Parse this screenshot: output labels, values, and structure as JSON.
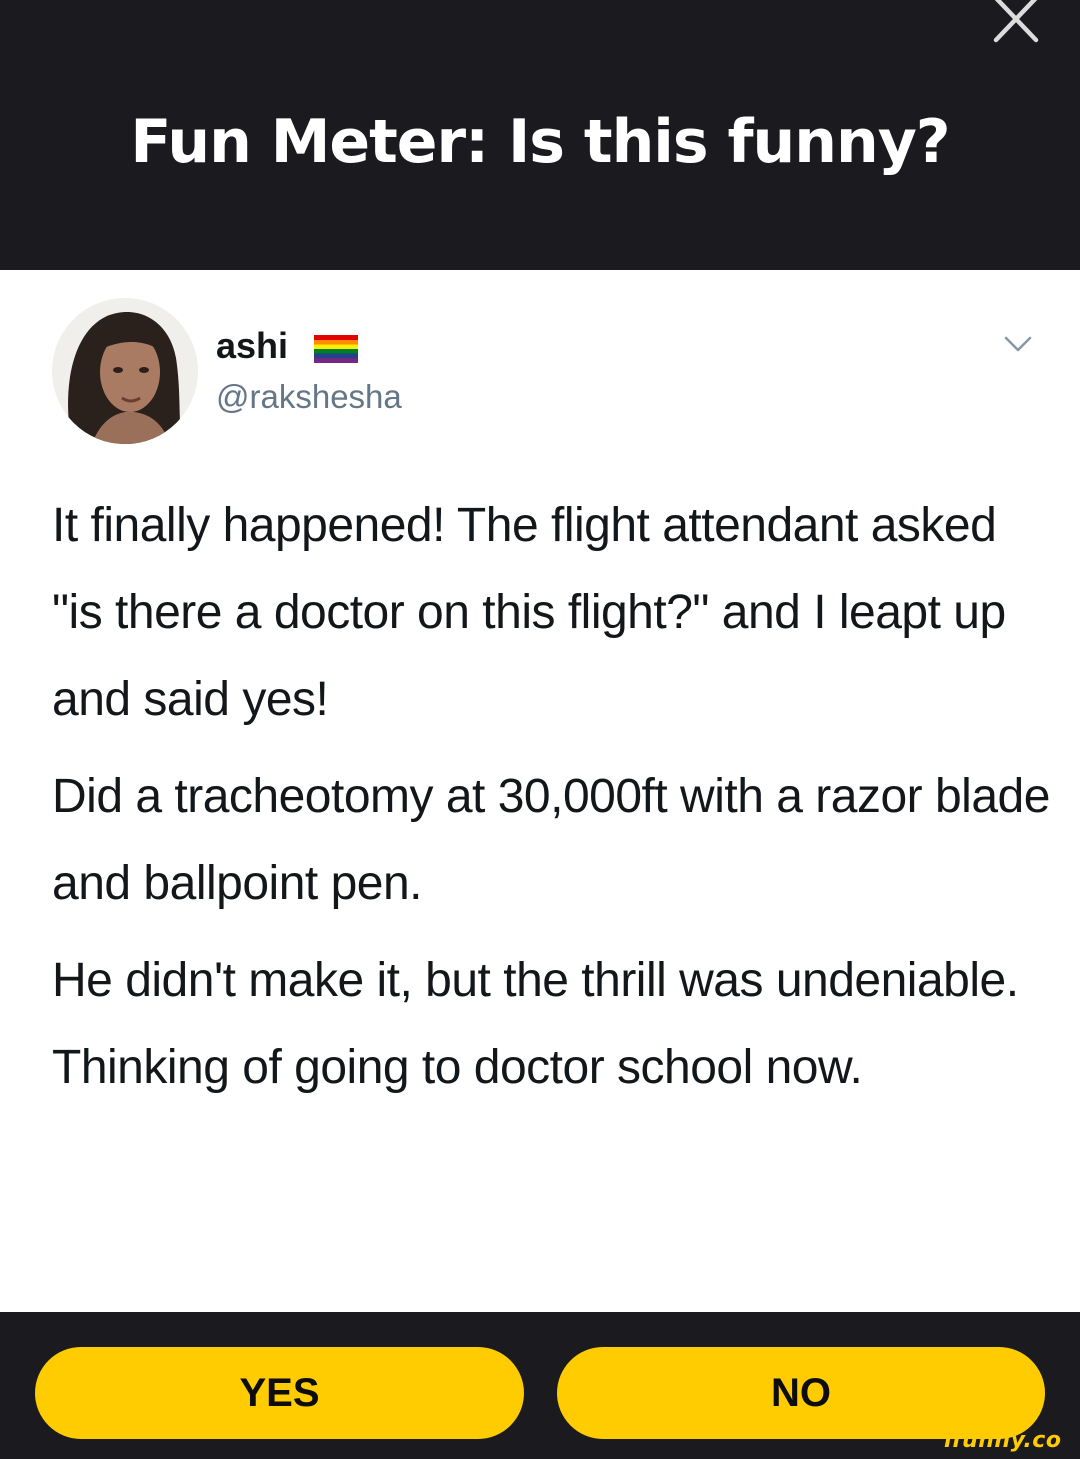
{
  "header": {
    "title": "Fun Meter: Is this funny?",
    "close_icon": "close-icon"
  },
  "tweet": {
    "user_name": "ashi",
    "user_name_emoji": "rainbow-pride-flag",
    "handle": "@rakshesha",
    "menu_icon": "chevron-down-icon",
    "paragraphs": [
      "It finally happened! The flight attendant asked \"is there a doctor on this flight?\" and I leapt up and said yes!",
      "Did a tracheotomy at 30,000ft with a razor blade and ballpoint pen.",
      "He didn't make it, but the thrill was undeniable. Thinking of going to doctor school now."
    ]
  },
  "vote": {
    "yes_label": "YES",
    "no_label": "NO"
  },
  "watermark": {
    "text": "ifunny.co"
  },
  "colors": {
    "background_dark": "#1b1b1f",
    "accent_yellow": "#fecc00",
    "card_white": "#ffffff",
    "text_dark": "#14171a",
    "handle_gray": "#657786"
  }
}
